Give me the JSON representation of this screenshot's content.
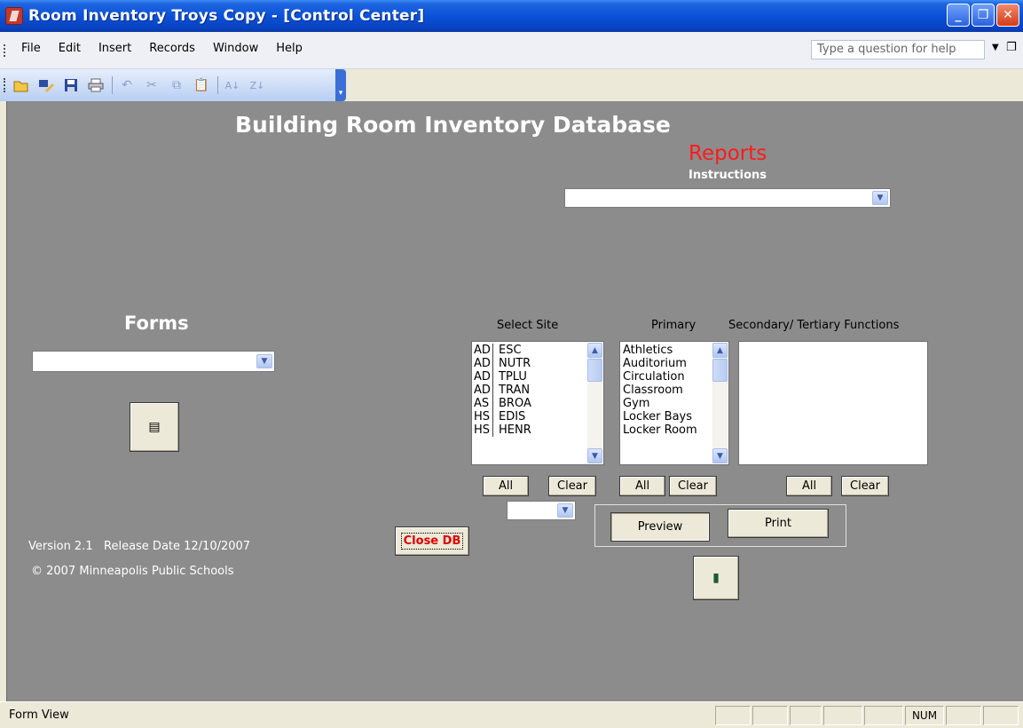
{
  "window": {
    "title": "Room Inventory Troys Copy - [Control Center]",
    "buttons": {
      "minimize": "_",
      "restore": "❐",
      "close": "✕"
    }
  },
  "menu": {
    "items": [
      "File",
      "Edit",
      "Insert",
      "Records",
      "Window",
      "Help"
    ],
    "help_placeholder": "Type a question for help"
  },
  "toolbar": {
    "icons": [
      "open-icon",
      "design-icon",
      "save-icon",
      "print-icon",
      "undo-icon",
      "cut-icon",
      "copy-icon",
      "paste-icon",
      "sort-ascending-icon",
      "sort-descending-icon"
    ]
  },
  "form": {
    "title": "Building Room Inventory Database",
    "reports": {
      "heading": "Reports",
      "instructions_label": "Instructions",
      "combo_value": ""
    },
    "forms": {
      "heading": "Forms",
      "combo_value": ""
    },
    "select_site": {
      "label": "Select Site",
      "rows": [
        {
          "c1": "AD",
          "c2": "ESC"
        },
        {
          "c1": "AD",
          "c2": "NUTR"
        },
        {
          "c1": "AD",
          "c2": "TPLU"
        },
        {
          "c1": "AD",
          "c2": "TRAN"
        },
        {
          "c1": "AS",
          "c2": "BROA"
        },
        {
          "c1": "HS",
          "c2": "EDIS"
        },
        {
          "c1": "HS",
          "c2": "HENR"
        }
      ],
      "all_label": "All",
      "clear_label": "Clear"
    },
    "primary": {
      "label": "Primary",
      "rows": [
        "Athletics",
        "Auditorium",
        "Circulation",
        "Classroom",
        "Gym",
        "Locker Bays",
        "Locker Room"
      ],
      "all_label": "All",
      "clear_label": "Clear"
    },
    "secondary": {
      "label": "Secondary/ Tertiary Functions",
      "rows": [],
      "all_label": "All",
      "clear_label": "Clear"
    },
    "preview_label": "Preview",
    "print_label": "Print",
    "close_db_label": "Close DB",
    "version_text": "Version 2.1   Release Date 12/10/2007",
    "copyright_text": "© 2007 Minneapolis Public Schools"
  },
  "status": {
    "mode": "Form View",
    "num": "NUM"
  }
}
